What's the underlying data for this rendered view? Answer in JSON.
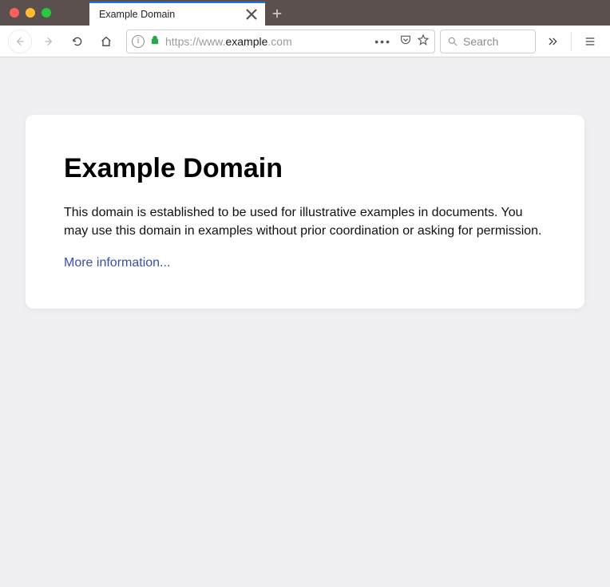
{
  "window": {
    "tab_title": "Example Domain"
  },
  "toolbar": {
    "url_scheme": "https://www.",
    "url_host": "example",
    "url_tld": ".com",
    "search_placeholder": "Search"
  },
  "page": {
    "heading": "Example Domain",
    "body": "This domain is established to be used for illustrative examples in documents. You may use this domain in examples without prior coordination or asking for permission.",
    "link_text": "More information..."
  }
}
